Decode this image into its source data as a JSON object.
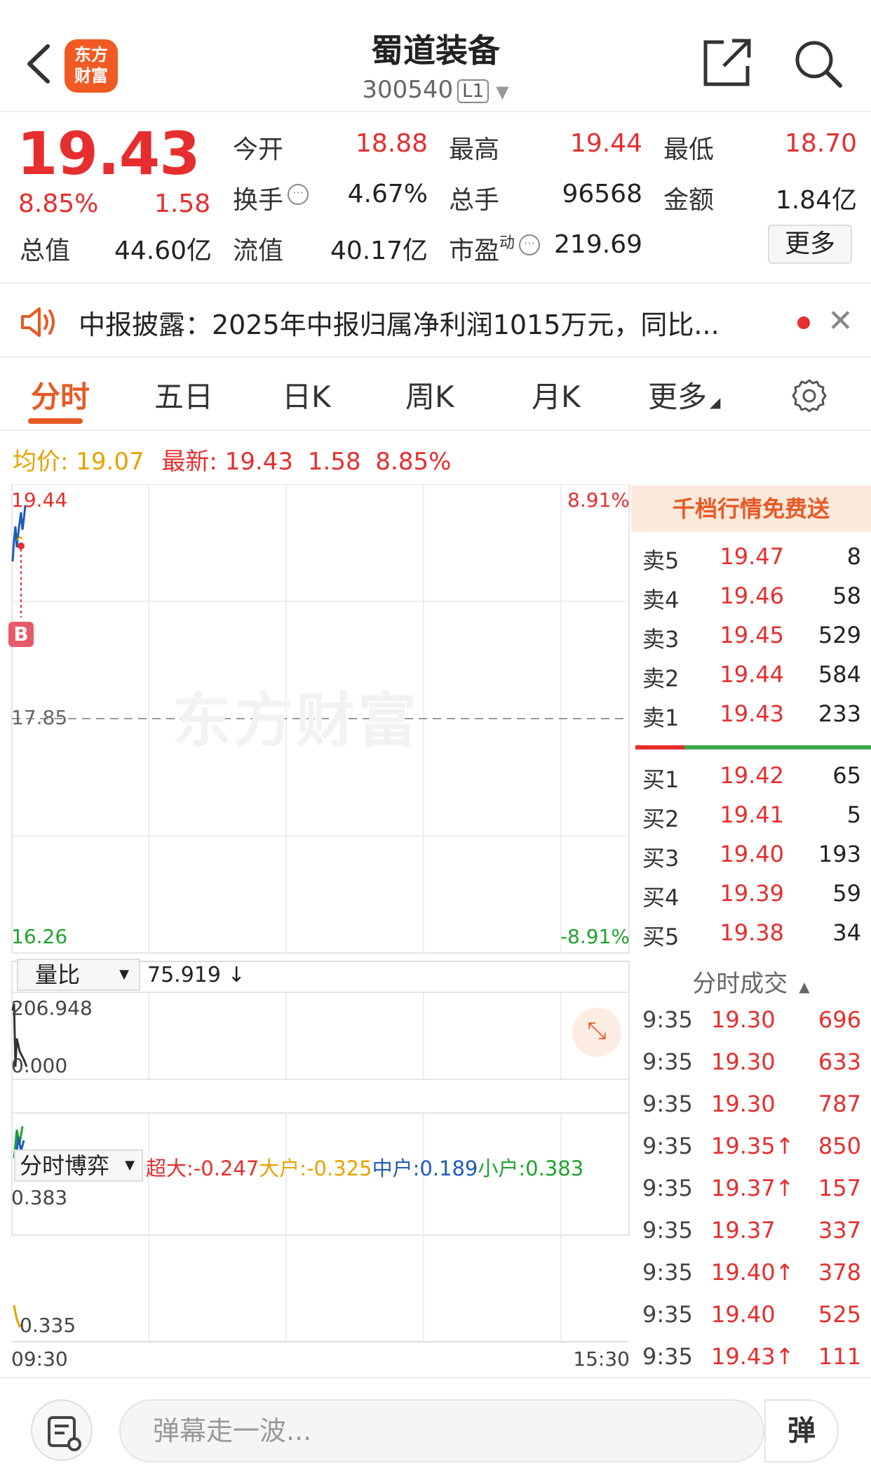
{
  "header": {
    "stock_name": "蜀道装备",
    "stock_code": "300540",
    "level": "L1",
    "logo_text_1": "东方",
    "logo_text_2": "财富"
  },
  "quote": {
    "price": "19.43",
    "change_pct": "8.85%",
    "change_abs": "1.58",
    "rows": [
      [
        {
          "label": "今开",
          "value": "18.88",
          "color": "red"
        },
        {
          "label": "最高",
          "value": "19.44",
          "color": "red"
        },
        {
          "label": "最低",
          "value": "18.70",
          "color": "red"
        }
      ],
      [
        {
          "label": "换手",
          "value": "4.67%",
          "color": "black"
        },
        {
          "label": "总手",
          "value": "96568",
          "color": "black"
        },
        {
          "label": "金额",
          "value": "1.84亿",
          "color": "black"
        }
      ],
      [
        {
          "label": "总值",
          "value": "44.60亿",
          "color": "black"
        },
        {
          "label": "流值",
          "value": "40.17亿",
          "color": "black"
        },
        {
          "label": "市盈",
          "label_sup": "动",
          "value": "219.69",
          "color": "black"
        }
      ]
    ],
    "more_label": "更多"
  },
  "notice": {
    "text": "中报披露：2025年中报归属净利润1015万元，同比..."
  },
  "tabs": [
    "分时",
    "五日",
    "日K",
    "周K",
    "月K",
    "更多"
  ],
  "active_tab": 0,
  "info": {
    "avg_label": "均价:",
    "avg_value": "19.07",
    "latest_label": "最新:",
    "latest_value": "19.43",
    "latest_change": "1.58",
    "latest_pct": "8.85%"
  },
  "main_chart": {
    "top_left": "19.44",
    "top_right": "8.91%",
    "mid": "17.85",
    "bottom_left": "16.26",
    "bottom_right": "-8.91%",
    "marker": "B",
    "watermark": "东方财富"
  },
  "volume_chart": {
    "selector": "量比",
    "current": "75.919 ↓",
    "top": "206.948",
    "bottom": "0.000"
  },
  "game_chart": {
    "selector": "分时博弈",
    "super_label": "超大:",
    "super_value": "-0.247",
    "big_label": "大户:",
    "big_value": "-0.325",
    "mid_label": "中户:",
    "mid_value": "0.189",
    "small_label": "小户:",
    "small_value": "0.383",
    "top": "0.383",
    "bottom": "0.335",
    "time_start": "09:30",
    "time_end": "15:30"
  },
  "order_book": {
    "promo": "千档行情免费送",
    "asks": [
      {
        "label": "卖5",
        "price": "19.47",
        "vol": "8"
      },
      {
        "label": "卖4",
        "price": "19.46",
        "vol": "58"
      },
      {
        "label": "卖3",
        "price": "19.45",
        "vol": "529"
      },
      {
        "label": "卖2",
        "price": "19.44",
        "vol": "584"
      },
      {
        "label": "卖1",
        "price": "19.43",
        "vol": "233"
      }
    ],
    "bids": [
      {
        "label": "买1",
        "price": "19.42",
        "vol": "65"
      },
      {
        "label": "买2",
        "price": "19.41",
        "vol": "5"
      },
      {
        "label": "买3",
        "price": "19.40",
        "vol": "193"
      },
      {
        "label": "买4",
        "price": "19.39",
        "vol": "59"
      },
      {
        "label": "买5",
        "price": "19.38",
        "vol": "34"
      }
    ],
    "trades_title": "分时成交",
    "trades": [
      {
        "time": "9:35",
        "price": "19.30",
        "vol": "696"
      },
      {
        "time": "9:35",
        "price": "19.30",
        "vol": "633"
      },
      {
        "time": "9:35",
        "price": "19.30",
        "vol": "787"
      },
      {
        "time": "9:35",
        "price": "19.35↑",
        "vol": "850"
      },
      {
        "time": "9:35",
        "price": "19.37↑",
        "vol": "157"
      },
      {
        "time": "9:35",
        "price": "19.37",
        "vol": "337"
      },
      {
        "time": "9:35",
        "price": "19.40↑",
        "vol": "378"
      },
      {
        "time": "9:35",
        "price": "19.40",
        "vol": "525"
      },
      {
        "time": "9:35",
        "price": "19.43↑",
        "vol": "111"
      }
    ]
  },
  "bottom": {
    "danmu_placeholder": "弹幕走一波...",
    "danmu_button": "弹"
  },
  "colors": {
    "up": "#e62e2e",
    "down": "#1fa22e",
    "accent": "#e65a24",
    "avg": "#e6a200",
    "mid_blue": "#1e5bb8"
  }
}
